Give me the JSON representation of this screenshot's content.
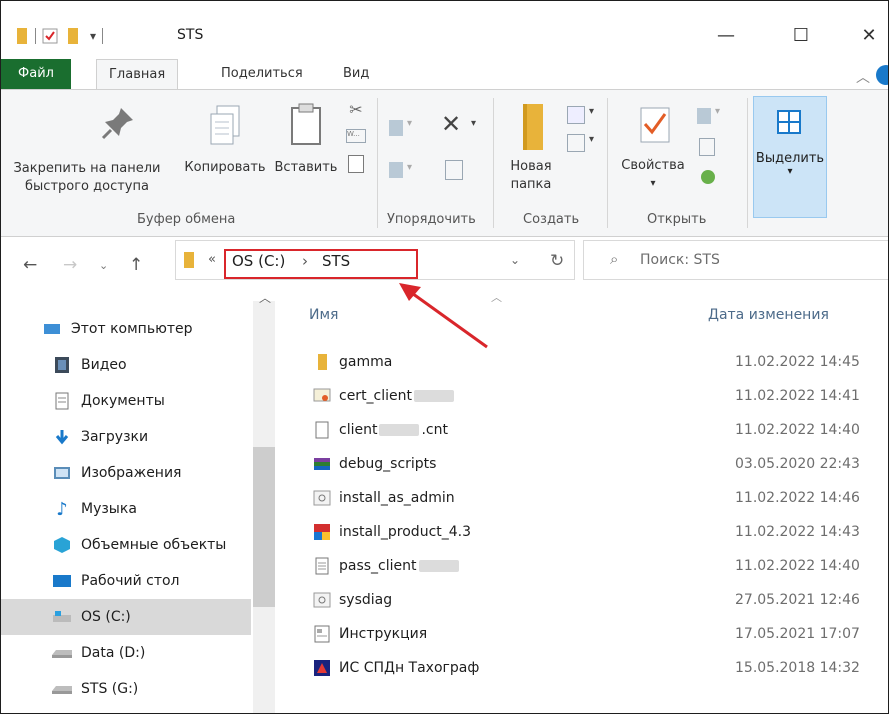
{
  "window": {
    "title": "STS",
    "controls": [
      "—",
      "☐",
      "✕"
    ]
  },
  "ribbon_tabs": [
    "Файл",
    "Главная",
    "Поделиться",
    "Вид"
  ],
  "ribbon": {
    "pin_label_1": "Закрепить на панели",
    "pin_label_2": "быстрого доступа",
    "copy_label": "Копировать",
    "paste_label": "Вставить",
    "group_clipboard": "Буфер обмена",
    "group_organize": "Упорядочить",
    "new_folder_label_1": "Новая",
    "new_folder_label_2": "папка",
    "group_create": "Создать",
    "properties_label": "Свойства",
    "group_open": "Открыть",
    "select_label": "Выделить"
  },
  "address": {
    "overflow": "«",
    "crumb_root": "OS (C:)",
    "crumb_sep": "›",
    "crumb_current": "STS",
    "search_placeholder": "Поиск: STS"
  },
  "nav": {
    "items": [
      {
        "label": "Этот компьютер",
        "icon": "computer-icon"
      },
      {
        "label": "Видео",
        "icon": "video-icon"
      },
      {
        "label": "Документы",
        "icon": "documents-icon"
      },
      {
        "label": "Загрузки",
        "icon": "downloads-icon"
      },
      {
        "label": "Изображения",
        "icon": "pictures-icon"
      },
      {
        "label": "Музыка",
        "icon": "music-icon"
      },
      {
        "label": "Объемные объекты",
        "icon": "3d-objects-icon"
      },
      {
        "label": "Рабочий стол",
        "icon": "desktop-icon"
      },
      {
        "label": "OS (C:)",
        "icon": "drive-icon"
      },
      {
        "label": "Data (D:)",
        "icon": "drive-icon"
      },
      {
        "label": "STS (G:)",
        "icon": "drive-icon"
      }
    ]
  },
  "list": {
    "col_name": "Имя",
    "col_date": "Дата изменения",
    "files": [
      {
        "name": "gamma",
        "date": "11.02.2022 14:45",
        "icon": "folder-icon"
      },
      {
        "name": "cert_client",
        "date": "11.02.2022 14:41",
        "icon": "certificate-icon"
      },
      {
        "name": "client",
        "suffix": ".cnt",
        "date": "11.02.2022 14:40",
        "icon": "blank-file-icon"
      },
      {
        "name": "debug_scripts",
        "date": "03.05.2020 22:43",
        "icon": "archive-icon"
      },
      {
        "name": "install_as_admin",
        "date": "11.02.2022 14:46",
        "icon": "script-icon"
      },
      {
        "name": "install_product_4.3",
        "date": "11.02.2022 14:43",
        "icon": "installer-icon"
      },
      {
        "name": "pass_client",
        "date": "11.02.2022 14:40",
        "icon": "text-file-icon"
      },
      {
        "name": "sysdiag",
        "date": "27.05.2021 12:46",
        "icon": "script-icon"
      },
      {
        "name": "Инструкция",
        "date": "17.05.2021 17:07",
        "icon": "document-icon"
      },
      {
        "name": "ИС СПДн Тахограф",
        "date": "15.05.2018 14:32",
        "icon": "app-icon"
      }
    ]
  },
  "colors": {
    "file_tab": "#1a6e2f",
    "annotation_red": "#d9262b",
    "selection_blue": "#cce4f7"
  }
}
